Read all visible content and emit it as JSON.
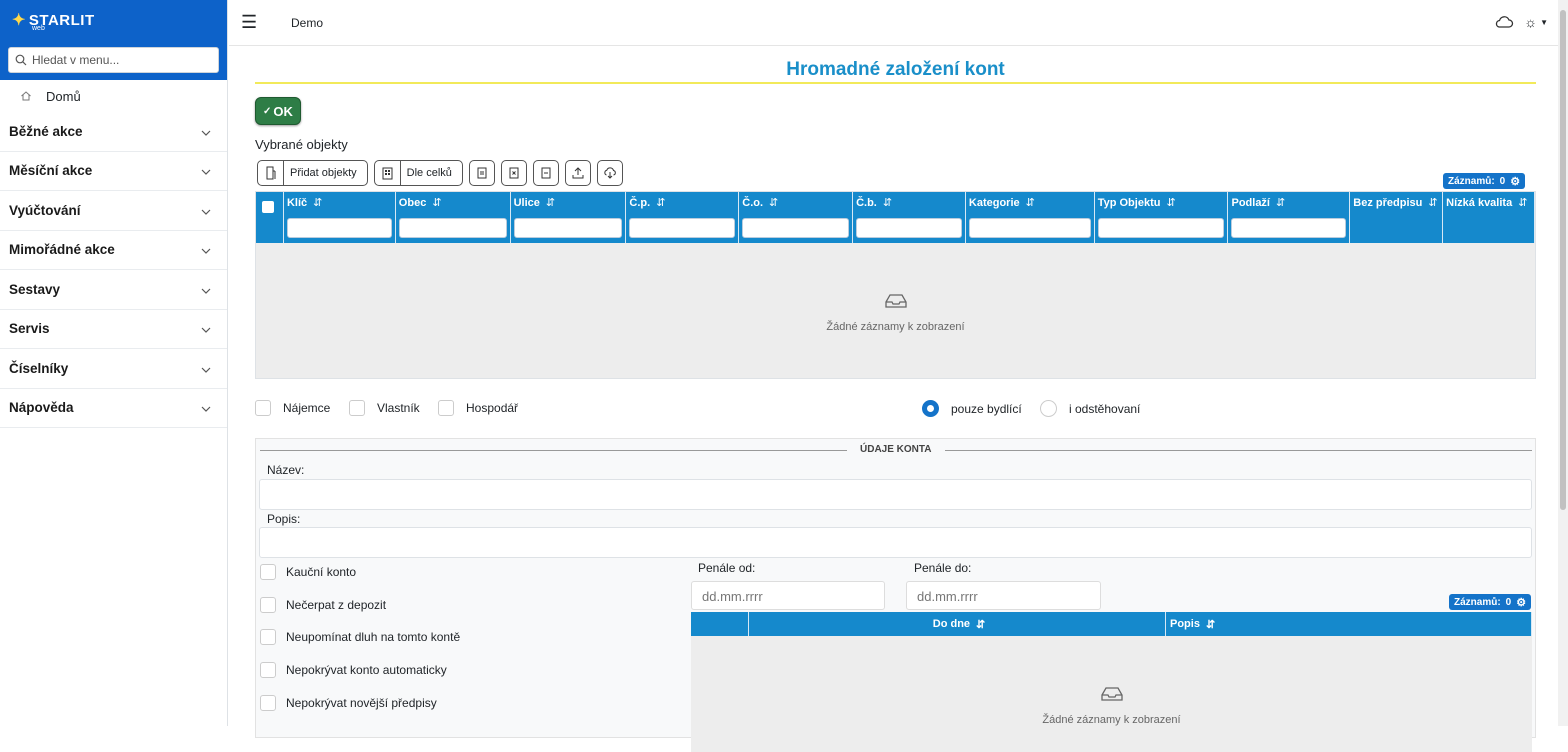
{
  "brand": {
    "name": "STARLIT",
    "sub": "web"
  },
  "sidebar": {
    "search_placeholder": "Hledat v menu...",
    "home": "Domů",
    "items": [
      {
        "label": "Běžné akce"
      },
      {
        "label": "Měsíční akce"
      },
      {
        "label": "Vyúčtování"
      },
      {
        "label": "Mimořádné akce"
      },
      {
        "label": "Sestavy"
      },
      {
        "label": "Servis"
      },
      {
        "label": "Číselníky"
      },
      {
        "label": "Nápověda"
      }
    ]
  },
  "topbar": {
    "breadcrumb": "Demo"
  },
  "page": {
    "title": "Hromadné založení kont",
    "ok_label": "OK",
    "selected_label": "Vybrané objekty",
    "toolbar": {
      "add_objects": "Přidat objekty",
      "by_units": "Dle celků"
    },
    "records_label": "Záznamů:",
    "records_count": "0",
    "columns": [
      "Klíč",
      "Obec",
      "Ulice",
      "Č.p.",
      "Č.o.",
      "Č.b.",
      "Kategorie",
      "Typ Objektu",
      "Podlaží",
      "Bez předpisu",
      "Nízká kvalita"
    ],
    "empty_text": "Žádné záznamy k zobrazení",
    "checks": {
      "tenant": "Nájemce",
      "owner": "Vlastník",
      "manager": "Hospodář"
    },
    "radios": {
      "only_living": "pouze bydlící",
      "also_moved": "i odstěhovaní"
    }
  },
  "account": {
    "legend": "ÚDAJE KONTA",
    "name_label": "Název:",
    "desc_label": "Popis:",
    "options": [
      "Kauční konto",
      "Nečerpat z depozit",
      "Neupomínat dluh na tomto kontě",
      "Nepokrývat konto automaticky",
      "Nepokrývat novější předpisy"
    ],
    "penalty_from_label": "Penále od:",
    "penalty_to_label": "Penále do:",
    "date_placeholder": "dd.mm.rrrr",
    "records_label": "Záznamů:",
    "records_count": "0",
    "columns": [
      "Do dne",
      "Popis"
    ],
    "empty_text": "Žádné záznamy k zobrazení"
  },
  "colors": {
    "brand": "#0d62c9",
    "header": "#1589cc",
    "title": "#1a8fc9",
    "ok": "#2e7d46"
  }
}
